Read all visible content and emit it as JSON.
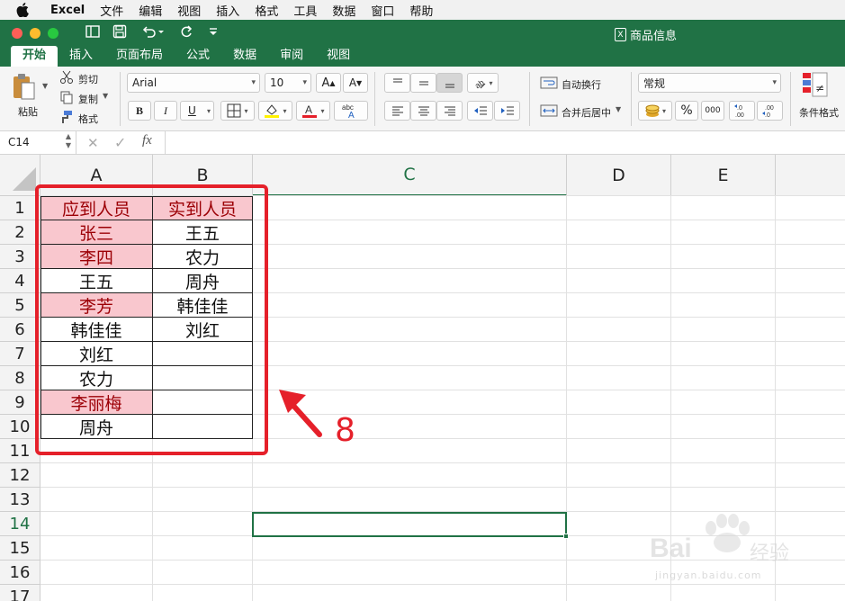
{
  "menubar": {
    "app": "Excel",
    "items": [
      "文件",
      "编辑",
      "视图",
      "插入",
      "格式",
      "工具",
      "数据",
      "窗口",
      "帮助"
    ]
  },
  "window": {
    "title": "商品信息",
    "tabs": [
      "开始",
      "插入",
      "页面布局",
      "公式",
      "数据",
      "审阅",
      "视图"
    ]
  },
  "ribbon": {
    "paste": "粘贴",
    "cut": "剪切",
    "copy": "复制",
    "format_painter": "格式",
    "font_name": "Arial",
    "font_size": "10",
    "bold": "B",
    "italic": "I",
    "underline": "U",
    "wrap_text": "自动换行",
    "merge_center": "合并后居中",
    "number_format": "常规",
    "percent": "%",
    "thousands": "000",
    "conditional_format": "条件格式"
  },
  "formula_bar": {
    "name_box": "C14",
    "fx": "fx",
    "value": ""
  },
  "sheet": {
    "columns": [
      "A",
      "B",
      "C",
      "D",
      "E"
    ],
    "rows": [
      "1",
      "2",
      "3",
      "4",
      "5",
      "6",
      "7",
      "8",
      "9",
      "10",
      "11",
      "12",
      "13",
      "14",
      "15",
      "16",
      "17"
    ],
    "col_a": [
      "应到人员",
      "张三",
      "李四",
      "王五",
      "李芳",
      "韩佳佳",
      "刘红",
      "农力",
      "李丽梅",
      "周舟"
    ],
    "col_b": [
      "实到人员",
      "王五",
      "农力",
      "周舟",
      "韩佳佳",
      "刘红",
      "",
      "",
      "",
      ""
    ],
    "highlighted_a_rows": [
      1,
      2,
      3,
      5,
      9
    ],
    "highlighted_b_rows": [
      1
    ],
    "highlight_fill": "#f9c7ce",
    "highlight_text": "#9c0006",
    "selected_cell": "C14",
    "accent": "#207245"
  },
  "annotation": {
    "label": "8",
    "color": "#e5202a"
  },
  "watermark": {
    "brand": "Bai",
    "brand_tail": "经验",
    "url": "jingyan.baidu.com"
  }
}
